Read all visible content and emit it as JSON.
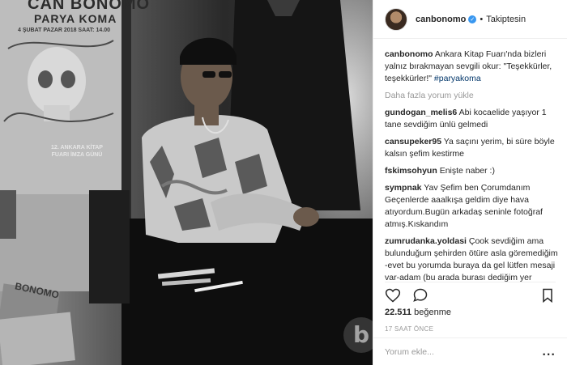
{
  "poster": {
    "title": "CAN BONOMO",
    "subtitle": "PARYA KOMA",
    "date_line": "4 ŞUBAT PAZAR 2018   SAAT: 14.00",
    "event": "12. ANKARA KİTAP FUARI İMZA GÜNÜ"
  },
  "album_text": "BONOMO",
  "watermark": "b",
  "post": {
    "username": "canbonomo",
    "follow_status": "Takiptesin",
    "caption_user": "canbonomo",
    "caption_text": "Ankara Kitap Fuarı'nda bizleri yalnız bırakmayan sevgili okur: \"Teşekkürler, teşekkürler!\"",
    "caption_tag": "#paryakoma",
    "load_more": "Daha fazla yorum yükle",
    "comments": [
      {
        "user": "gundogan_melis6",
        "text": "Abi kocaelide yaşıyor 1 tane sevdiğim ünlü gelmedi"
      },
      {
        "user": "cansupeker95",
        "text": "Ya saçını yerim, bi süre böyle kalsın şefim kestirme"
      },
      {
        "user": "fskimsohyun",
        "text": "Enişte naber :)"
      },
      {
        "user": "sympnak",
        "text": "Yav Şefim ben Çorumdanım Geçenlerde aaalkışa geldim diye hava atıyordum.Bugün arkadaş seninle fotoğraf atmış.Kıskandım"
      },
      {
        "user": "zumrudanka.yoldasi",
        "text": "Çook sevdiğim ama bulunduğum şehirden ötüre asla göremediğim -evet bu yorumda buraya da gel lütfen mesaji var-adam (bu arada burası dediğim yer Malatya)"
      }
    ],
    "likes_count": "22.511",
    "likes_label": "beğenme",
    "time": "17 SAAT ÖNCE",
    "comment_placeholder": "Yorum ekle...",
    "options_icon": "..."
  },
  "icons": {
    "heart": "heart-icon",
    "comment": "comment-icon",
    "bookmark": "bookmark-icon",
    "verified": "verified-badge-icon"
  }
}
